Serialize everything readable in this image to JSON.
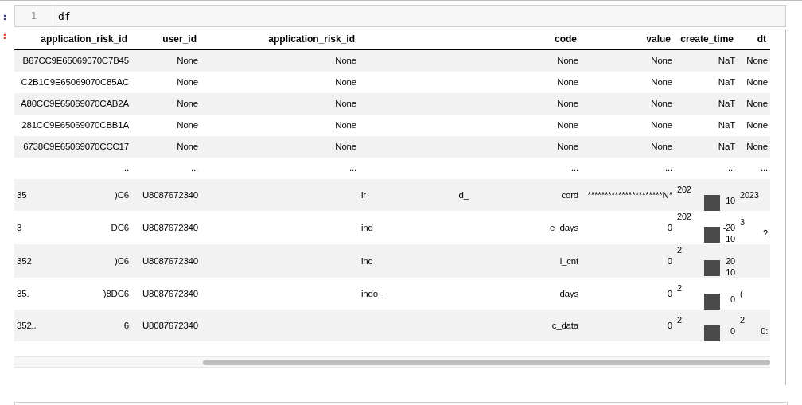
{
  "input_cell": {
    "prompt": ":",
    "line_number": "1",
    "code": "df"
  },
  "output_cell": {
    "prompt": ":",
    "table": {
      "columns": [
        "application_risk_id",
        "user_id",
        "application_risk_id",
        "code",
        "value",
        "create_time",
        "dt"
      ],
      "rows": [
        {
          "kind": "data",
          "cells": [
            "B67CC9E65069070C7B45",
            "None",
            "None",
            "None",
            "None",
            "NaT",
            "None"
          ]
        },
        {
          "kind": "data",
          "cells": [
            "C2B1C9E65069070C85AC",
            "None",
            "None",
            "None",
            "None",
            "NaT",
            "None"
          ]
        },
        {
          "kind": "data",
          "cells": [
            "A80CC9E65069070CAB2A",
            "None",
            "None",
            "None",
            "None",
            "NaT",
            "None"
          ]
        },
        {
          "kind": "data",
          "cells": [
            "281CC9E65069070CBB1A",
            "None",
            "None",
            "None",
            "None",
            "NaT",
            "None"
          ]
        },
        {
          "kind": "data",
          "cells": [
            "6738C9E65069070CCC17",
            "None",
            "None",
            "None",
            "None",
            "NaT",
            "None"
          ]
        },
        {
          "kind": "data",
          "cells": [
            "...",
            "...",
            "...",
            "...",
            "...",
            "...",
            "..."
          ]
        },
        {
          "kind": "masked",
          "cells": [
            [
              "35",
              ")C6"
            ],
            [
              "U8087672340"
            ],
            null,
            [
              "ir",
              "d_",
              "cord"
            ],
            [
              "**********************N*"
            ],
            [
              "202",
              "10"
            ],
            [
              "2023"
            ]
          ]
        },
        {
          "kind": "masked",
          "cells": [
            [
              "3",
              "DC6"
            ],
            [
              "U8087672340"
            ],
            null,
            [
              "ind",
              "e_days"
            ],
            [
              "0"
            ],
            [
              "202",
              "-20",
              "10"
            ],
            [
              "3",
              "?"
            ]
          ]
        },
        {
          "kind": "masked",
          "cells": [
            [
              "352",
              ")C6"
            ],
            [
              "U8087672340"
            ],
            null,
            [
              "inc",
              "l_cnt"
            ],
            [
              "0"
            ],
            [
              "2",
              "20",
              "10"
            ],
            null
          ]
        },
        {
          "kind": "masked",
          "cells": [
            [
              "35.",
              ")8DC6"
            ],
            [
              "U8087672340"
            ],
            null,
            [
              "indo_",
              "days"
            ],
            [
              "0"
            ],
            [
              "2",
              "0"
            ],
            [
              "("
            ]
          ]
        },
        {
          "kind": "masked",
          "cells": [
            [
              "352..",
              "6"
            ],
            [
              "U8087672340"
            ],
            null,
            [
              "c_data"
            ],
            [
              "0"
            ],
            [
              "2",
              "0"
            ],
            [
              "2",
              "0:"
            ]
          ]
        }
      ]
    }
  }
}
